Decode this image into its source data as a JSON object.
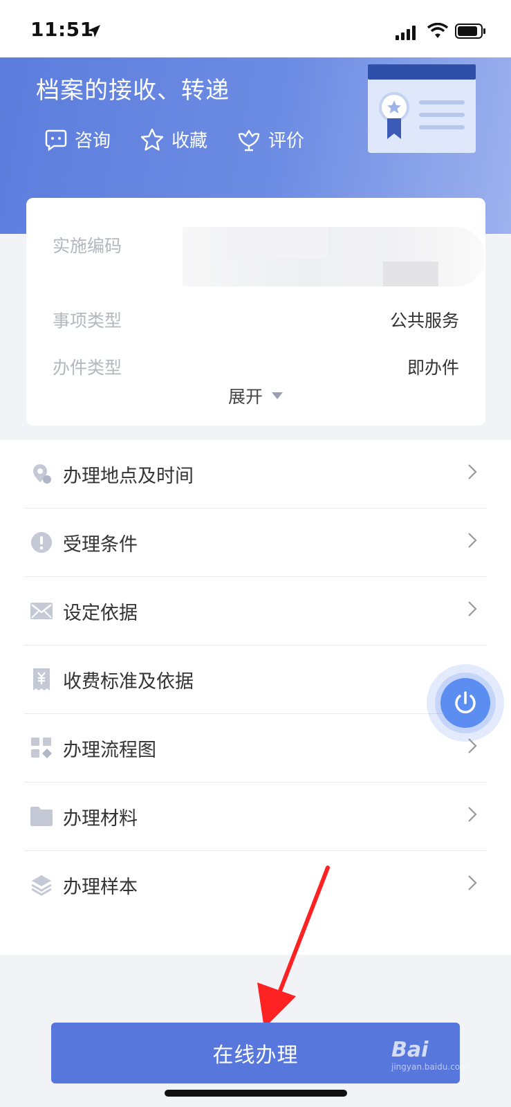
{
  "status_bar": {
    "time": "11:51"
  },
  "header": {
    "title": "档案的接收、转递",
    "actions": [
      {
        "label": "咨询",
        "icon": "chat-icon"
      },
      {
        "label": "收藏",
        "icon": "star-icon"
      },
      {
        "label": "评价",
        "icon": "evaluate-icon"
      }
    ]
  },
  "info": {
    "rows": [
      {
        "label": "实施编码",
        "value": ""
      },
      {
        "label": "事项类型",
        "value": "公共服务"
      },
      {
        "label": "办件类型",
        "value": "即办件"
      }
    ],
    "expand_label": "展开"
  },
  "menu": {
    "items": [
      {
        "label": "办理地点及时间",
        "icon": "location-icon"
      },
      {
        "label": "受理条件",
        "icon": "exclamation-icon"
      },
      {
        "label": "设定依据",
        "icon": "envelope-icon"
      },
      {
        "label": "收费标准及依据",
        "icon": "yuan-receipt-icon"
      },
      {
        "label": "办理流程图",
        "icon": "grid-icon"
      },
      {
        "label": "办理材料",
        "icon": "folder-icon"
      },
      {
        "label": "办理样本",
        "icon": "layers-icon"
      }
    ]
  },
  "bottom": {
    "button_label": "在线办理"
  },
  "watermark": {
    "text": "Bai",
    "sub": "jingyan.baidu.com"
  },
  "colors": {
    "primary": "#5777dc",
    "banner": "#5c7ddd",
    "float": "#5b8ef0",
    "arrow": "#f22"
  }
}
